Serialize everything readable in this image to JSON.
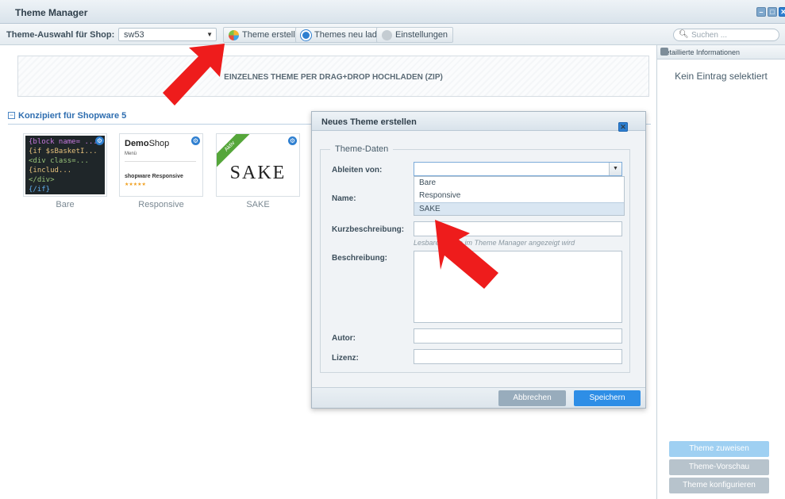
{
  "window": {
    "title": "Theme Manager"
  },
  "toolbar": {
    "shop_label": "Theme-Auswahl für Shop:",
    "shop_value": "sw53",
    "create_theme": "Theme erstellen",
    "reload_themes": "Themes neu laden",
    "settings": "Einstellungen",
    "search_placeholder": "Suchen ..."
  },
  "content": {
    "dropzone_text": "EINZELNES THEME PER DRAG+DROP HOCHLADEN (ZIP)",
    "group_label": "Konzipiert für Shopware 5",
    "themes": [
      {
        "name": "Bare"
      },
      {
        "name": "Responsive",
        "brand_bold": "Demo",
        "brand_rest": "Shop",
        "menu": "Menü",
        "product": "shopware Responsive"
      },
      {
        "name": "SAKE",
        "ribbon": "Aktiv",
        "logo": "SAKE"
      }
    ],
    "bare_code": [
      "{block name= ...",
      "  {if $sBasketI...",
      "    <div class=...",
      "      {includ...",
      "    </div>",
      "  {/if}"
    ]
  },
  "right_panel": {
    "header": "Detaillierte Informationen",
    "empty_text": "Kein Eintrag selektiert",
    "assign_theme": "Theme zuweisen",
    "preview_theme": "Theme-Vorschau",
    "configure_theme": "Theme konfigurieren"
  },
  "dialog": {
    "title": "Neues Theme erstellen",
    "legend": "Theme-Daten",
    "labels": {
      "derive": "Ableiten von:",
      "name": "Name:",
      "short_desc": "Kurzbeschreibung:",
      "desc": "Beschreibung:",
      "author": "Autor:",
      "license": "Lizenz:"
    },
    "derive_options": [
      "Bare",
      "Responsive",
      "SAKE"
    ],
    "selected_option": "SAKE",
    "hint": "Lesbarer Name im Theme Manager angezeigt wird",
    "cancel": "Abbrechen",
    "save": "Speichern"
  },
  "colors": {
    "accent": "#2e7fd0",
    "arrow": "#ee1c1c",
    "disabled_button": "#9fb0bc"
  }
}
